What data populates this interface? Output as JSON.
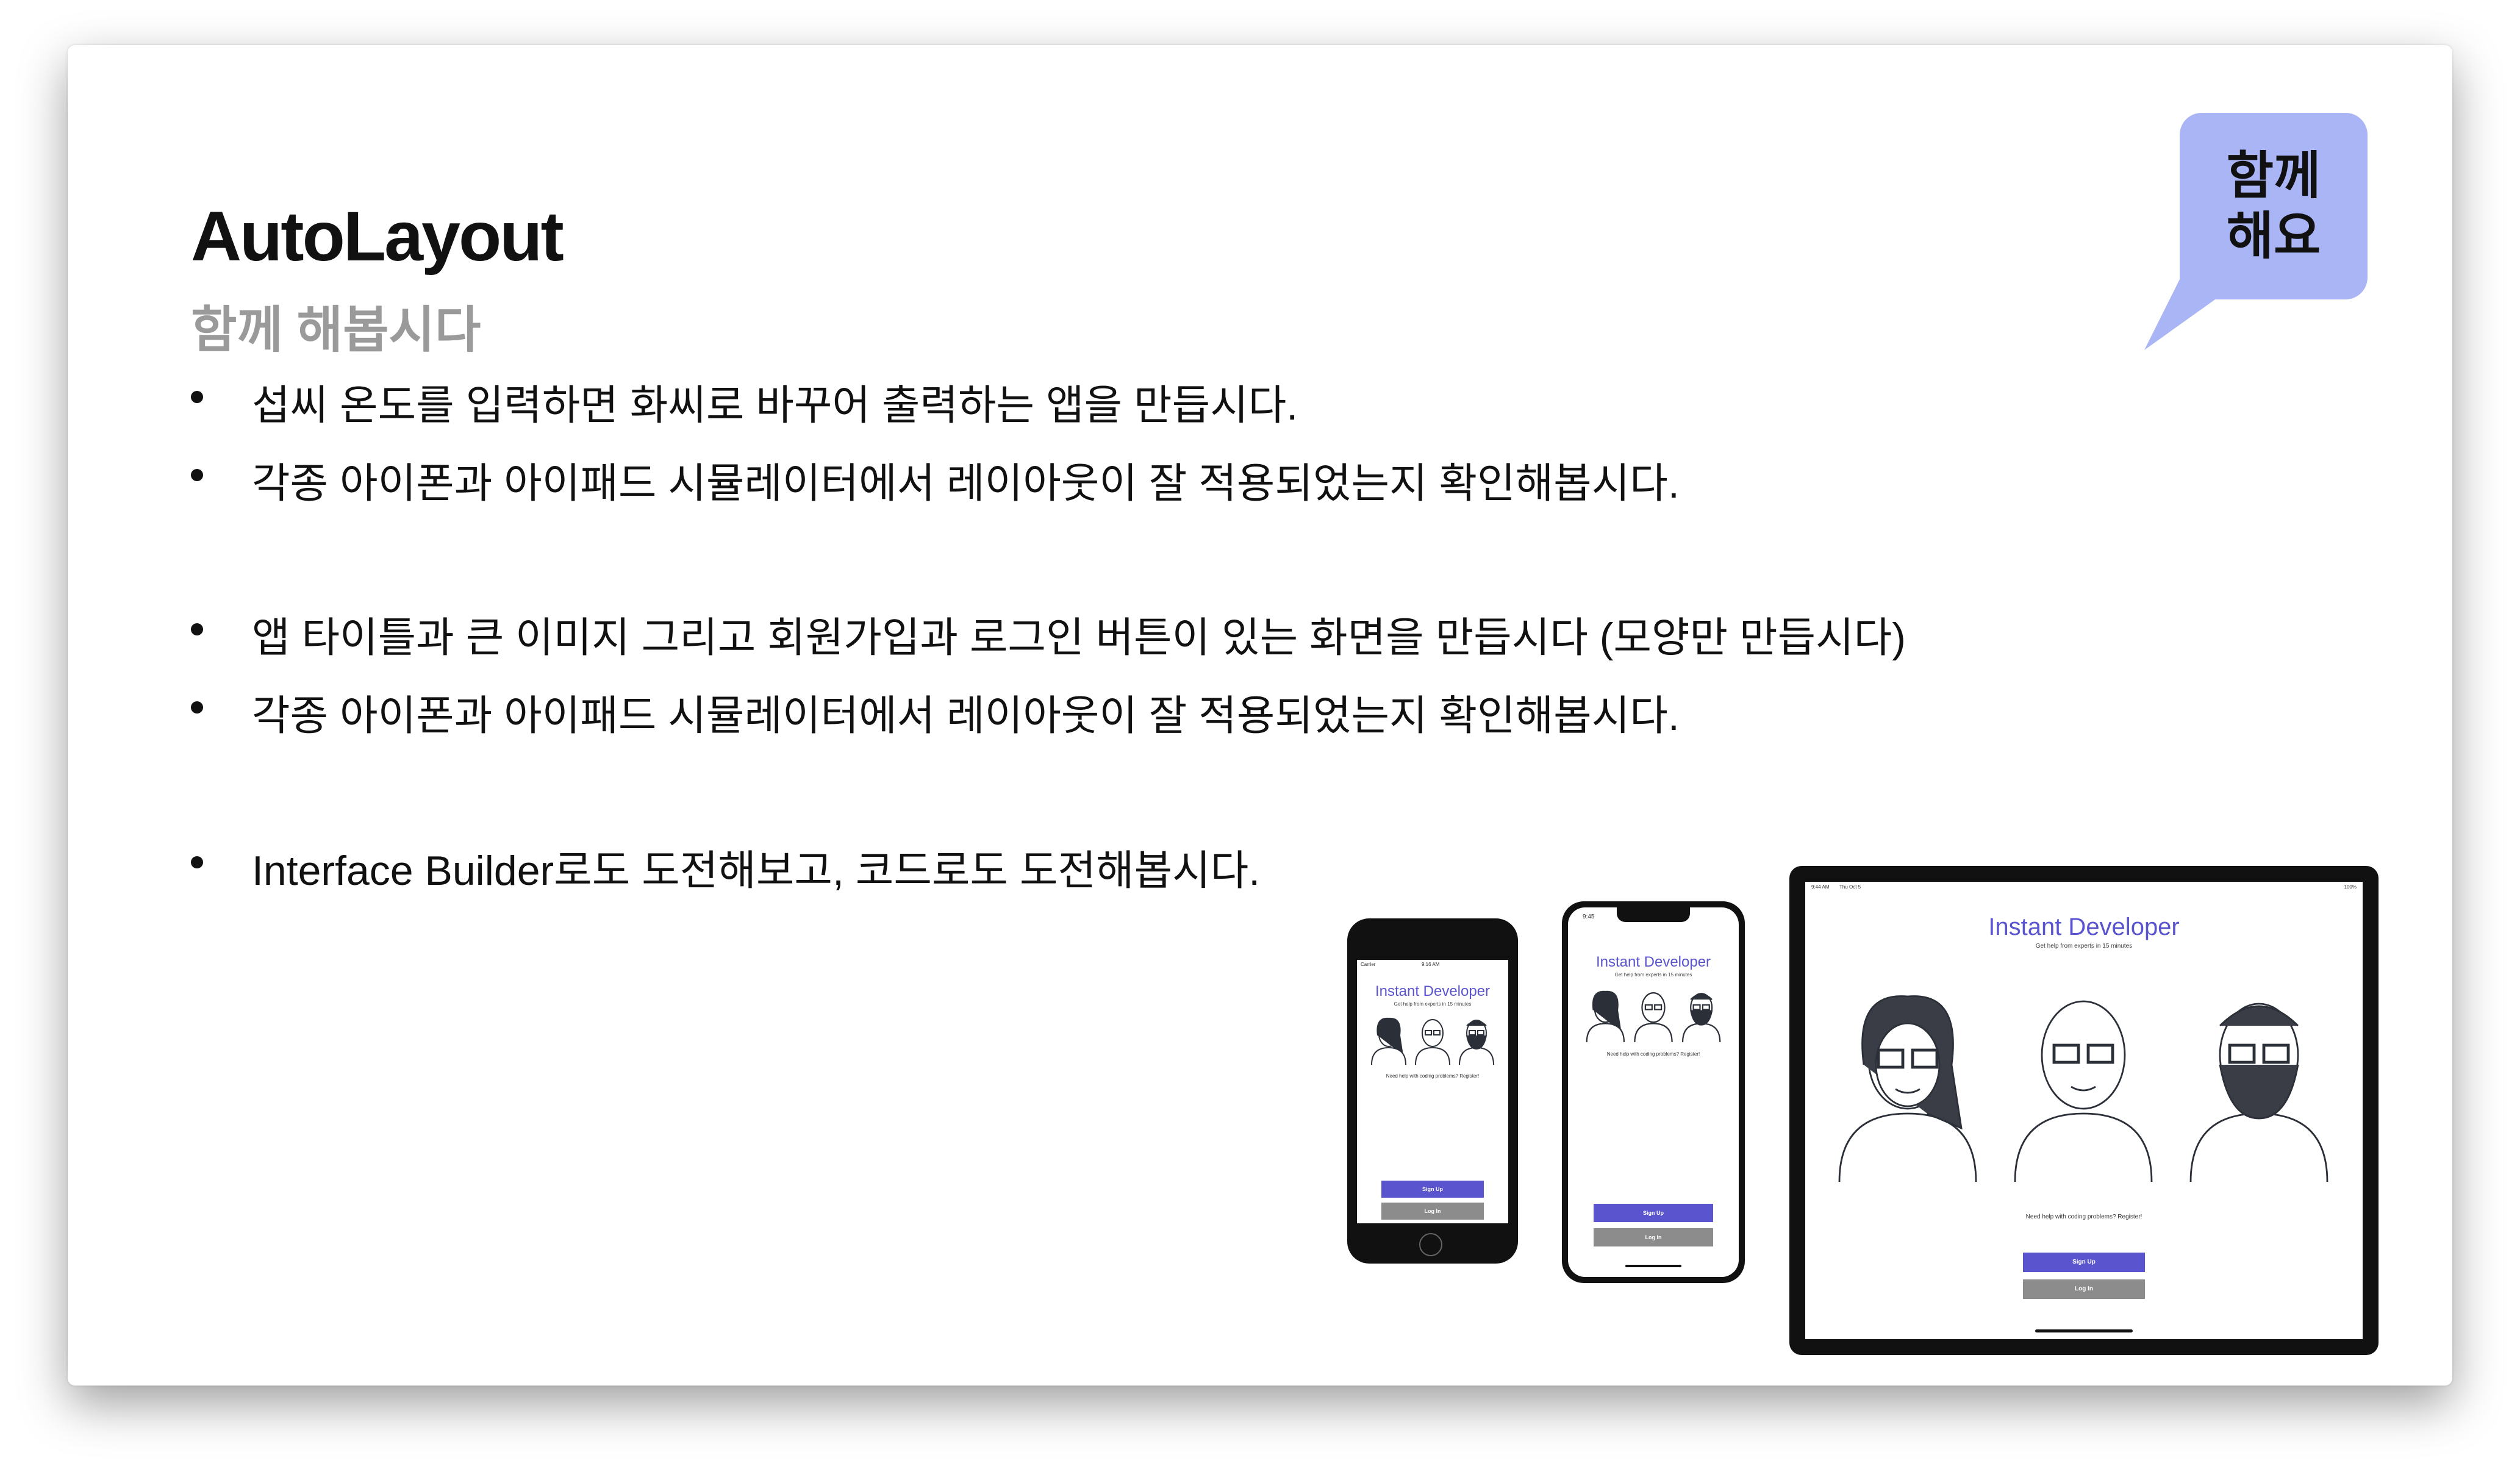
{
  "slide": {
    "title": "AutoLayout",
    "subtitle": "함께 해봅시다"
  },
  "badge": {
    "line1": "함께",
    "line2": "해요",
    "color": "#aab5f6"
  },
  "bullets": [
    "섭씨 온도를 입력하면 화씨로 바꾸어 출력하는 앱을 만듭시다.",
    "각종 아이폰과 아이패드 시뮬레이터에서 레이아웃이 잘 적용되었는지 확인해봅시다.",
    "앱 타이틀과 큰 이미지 그리고 회원가입과 로그인 버튼이 있는 화면을 만듭시다 (모양만 만듭시다)",
    "각종 아이폰과 아이패드 시뮬레이터에서 레이아웃이 잘 적용되었는지 확인해봅시다.",
    "Interface Builder로도 도전해보고, 코드로도 도전해봅시다."
  ],
  "mockup": {
    "app_title": "Instant Developer",
    "app_subtitle": "Get help from experts in 15 minutes",
    "help_text": "Need help with coding problems? Register!",
    "signup_label": "Sign Up",
    "login_label": "Log In",
    "accent_color": "#5a54cf",
    "login_color": "#8c8c8c",
    "iphone8_status": {
      "carrier": "Carrier",
      "time": "9:16 AM"
    },
    "iphonex_status": {
      "time": "9:45"
    },
    "ipad_status": {
      "time": "9:44 AM",
      "date": "Thu Oct 5",
      "battery": "100%"
    }
  }
}
